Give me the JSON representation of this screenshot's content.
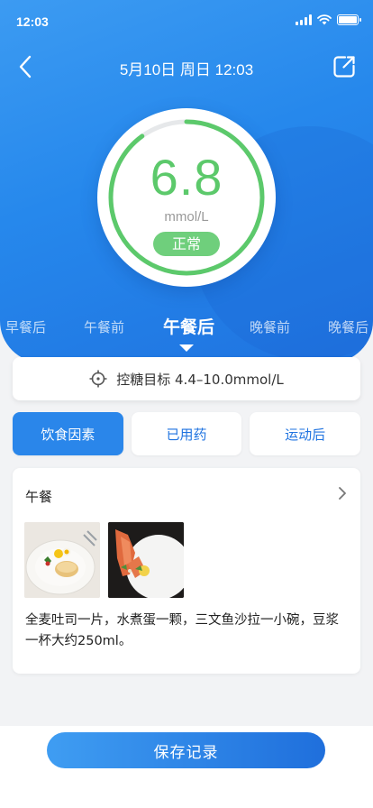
{
  "status_bar": {
    "time": "12:03"
  },
  "header": {
    "title": "5月10日 周日 12:03"
  },
  "reading": {
    "value": "6.8",
    "unit": "mmol/L",
    "status": "正常",
    "gauge_fill_fraction": 0.9
  },
  "meal_tabs": {
    "items": [
      "早餐后",
      "午餐前",
      "午餐后",
      "晚餐前",
      "晚餐后"
    ],
    "active_index": 2
  },
  "target": {
    "label": "控糖目标 4.4–10.0mmol/L"
  },
  "factors": {
    "items": [
      "饮食因素",
      "已用药",
      "运动后"
    ],
    "active_index": 0
  },
  "meal": {
    "title": "午餐",
    "description": "全麦吐司一片，水煮蛋一颗，三文鱼沙拉一小碗，豆浆一杯大约250ml。"
  },
  "save": {
    "label": "保存记录"
  },
  "colors": {
    "primary": "#2688ec",
    "normal_green": "#5cc96b"
  },
  "icons": [
    "back-icon",
    "share-icon",
    "target-icon",
    "chevron-right-icon"
  ]
}
